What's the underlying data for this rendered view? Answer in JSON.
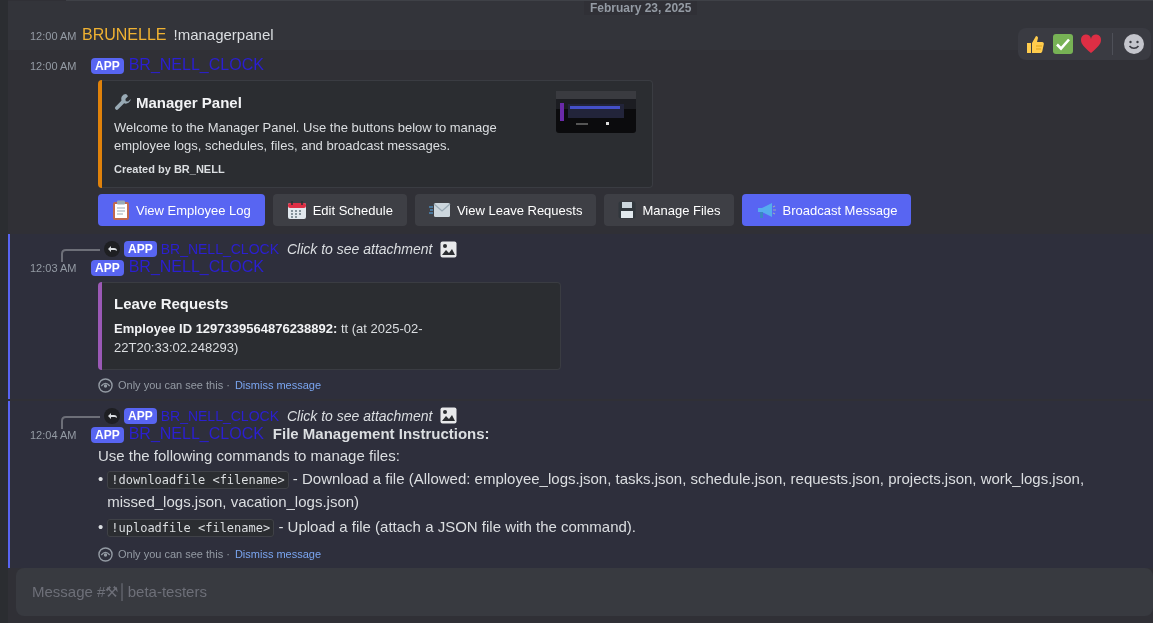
{
  "date_divider": "February 23, 2025",
  "messages": [
    {
      "kind": "user",
      "hovered": true,
      "time": "12:00 AM",
      "author": "BRUNELLE",
      "color": "#f0b232",
      "content": "!managerpanel"
    },
    {
      "kind": "bot",
      "ephemeral": false,
      "time": "12:00 AM",
      "badge": "APP",
      "author": "BR_NELL_CLOCK",
      "color": "#2b1fd1",
      "embed": {
        "color": "#e0820b",
        "title": "Manager Panel",
        "description": "Welcome to the Manager Panel. Use the buttons below to manage employee logs, schedules, files, and broadcast messages.",
        "footer": "Created by BR_NELL"
      },
      "buttons": [
        {
          "label": "View Employee Log",
          "kind": "primary"
        },
        {
          "label": "Edit Schedule",
          "kind": "secondary"
        },
        {
          "label": "View Leave Requests",
          "kind": "secondary"
        },
        {
          "label": "Manage Files",
          "kind": "secondary"
        },
        {
          "label": "Broadcast Message",
          "kind": "primary"
        }
      ]
    },
    {
      "kind": "bot",
      "ephemeral": true,
      "reply": {
        "badge": "APP",
        "author": "BR_NELL_CLOCK",
        "text": "Click to see attachment"
      },
      "time": "12:03 AM",
      "badge": "APP",
      "author": "BR_NELL_CLOCK",
      "color": "#2b1fd1",
      "embed": {
        "color": "#9b59b6",
        "title": "Leave Requests",
        "description": "**Employee ID 1297339564876238892:** tt (at 2025-02-22T20:33:02.248293)"
      },
      "notice": "Only you can see this ·",
      "dismiss": "Dismiss message"
    },
    {
      "kind": "bot",
      "ephemeral": true,
      "reply": {
        "badge": "APP",
        "author": "BR_NELL_CLOCK",
        "text": "Click to see attachment"
      },
      "time": "12:04 AM",
      "badge": "APP",
      "author": "BR_NELL_CLOCK",
      "color": "#2b1fd1",
      "heading": "File Management Instructions:",
      "lines": [
        {
          "kind": "text",
          "text": "Use the following commands to manage files:"
        },
        {
          "kind": "bullet",
          "bullet": "•",
          "code": "!downloadfile <filename>",
          "text": "- Download a file (Allowed: employee_logs.json, tasks.json, schedule.json, requests.json, projects.json, work_logs.json, missed_logs.json, vacation_logs.json)"
        },
        {
          "kind": "bullet",
          "bullet": "•",
          "code": "!uploadfile <filename>",
          "text": "- Upload a file (attach a JSON file with the command)."
        }
      ],
      "notice": "Only you can see this ·",
      "dismiss": "Dismiss message"
    }
  ],
  "composer": {
    "placeholder": "Message #⚒│beta-testers"
  }
}
